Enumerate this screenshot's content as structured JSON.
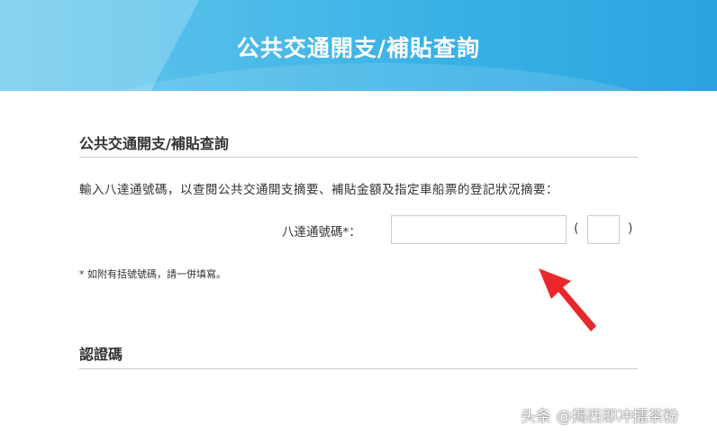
{
  "header": {
    "title": "公共交通開支/補貼查詢"
  },
  "query_section": {
    "title": "公共交通開支/補貼查詢",
    "instruction": "輸入八達通號碼，以查閱公共交通開支摘要、補貼金額及指定車船票的登記狀況摘要：",
    "card_number_label": "八達通號碼*：",
    "card_number_value": "",
    "check_digit_value": "",
    "paren_open": "(",
    "paren_close": ")",
    "note": "* 如附有括號號碼，請一併填寫。"
  },
  "verification_section": {
    "title": "認證碼"
  },
  "watermark": {
    "text": "头条 @揭西即冲擂茶粉"
  },
  "colors": {
    "header_bg": "#3ab2e6",
    "arrow": "#e8282b",
    "divider": "#cccccc"
  }
}
